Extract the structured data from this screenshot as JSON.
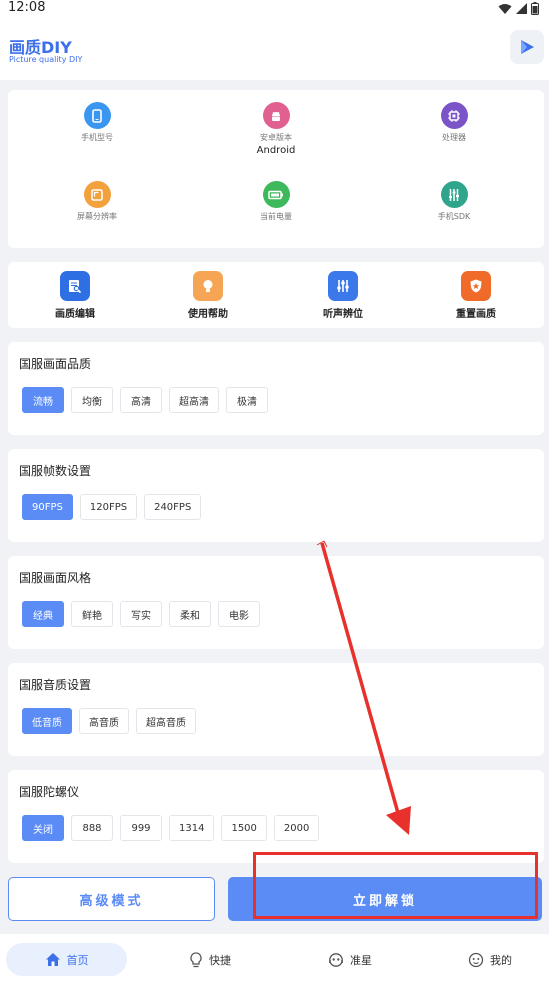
{
  "status": {
    "time": "12:08"
  },
  "header": {
    "title": "画质DIY",
    "subtitle": "Picture quality DIY"
  },
  "device_info": [
    {
      "label": "手机型号",
      "value": "",
      "icon": "phone-icon",
      "color": "#3a96f0"
    },
    {
      "label": "安卓版本",
      "value": "Android",
      "icon": "android-icon",
      "color": "#e0608f"
    },
    {
      "label": "处理器",
      "value": "",
      "icon": "chip-icon",
      "color": "#7b55c8"
    },
    {
      "label": "屏幕分辨率",
      "value": "",
      "icon": "screen-icon",
      "color": "#f3a13c"
    },
    {
      "label": "当前电量",
      "value": "",
      "icon": "battery-icon",
      "color": "#3db85a"
    },
    {
      "label": "手机SDK",
      "value": "",
      "icon": "sliders-icon",
      "color": "#2fa58b"
    }
  ],
  "functions": [
    {
      "label": "画质编辑",
      "icon": "edit-icon",
      "color": "#2f6fe4"
    },
    {
      "label": "使用帮助",
      "icon": "bulb-icon",
      "color": "#f5a553"
    },
    {
      "label": "听声辨位",
      "icon": "tuner-icon",
      "color": "#3b78ea"
    },
    {
      "label": "重置画质",
      "icon": "shield-icon",
      "color": "#f06a2a"
    }
  ],
  "sections": [
    {
      "title": "国服画面品质",
      "options": [
        "流畅",
        "均衡",
        "高清",
        "超高清",
        "极清"
      ],
      "selected": 0
    },
    {
      "title": "国服帧数设置",
      "options": [
        "90FPS",
        "120FPS",
        "240FPS"
      ],
      "selected": 0
    },
    {
      "title": "国服画面风格",
      "options": [
        "经典",
        "鲜艳",
        "写实",
        "柔和",
        "电影"
      ],
      "selected": 0
    },
    {
      "title": "国服音质设置",
      "options": [
        "低音质",
        "高音质",
        "超高音质"
      ],
      "selected": 0
    },
    {
      "title": "国服陀螺仪",
      "options": [
        "关闭",
        "888",
        "999",
        "1314",
        "1500",
        "2000"
      ],
      "selected": 0
    }
  ],
  "actions": {
    "advanced_label": "高级模式",
    "unlock_label": "立即解锁"
  },
  "tabs": [
    {
      "label": "首页",
      "icon": "home-icon",
      "active": true
    },
    {
      "label": "快捷",
      "icon": "lightbulb-icon",
      "active": false
    },
    {
      "label": "准星",
      "icon": "crosshair-icon",
      "active": false
    },
    {
      "label": "我的",
      "icon": "smiley-icon",
      "active": false
    }
  ],
  "colors": {
    "accent": "#5b8cf6",
    "annotation": "#e8302c"
  }
}
